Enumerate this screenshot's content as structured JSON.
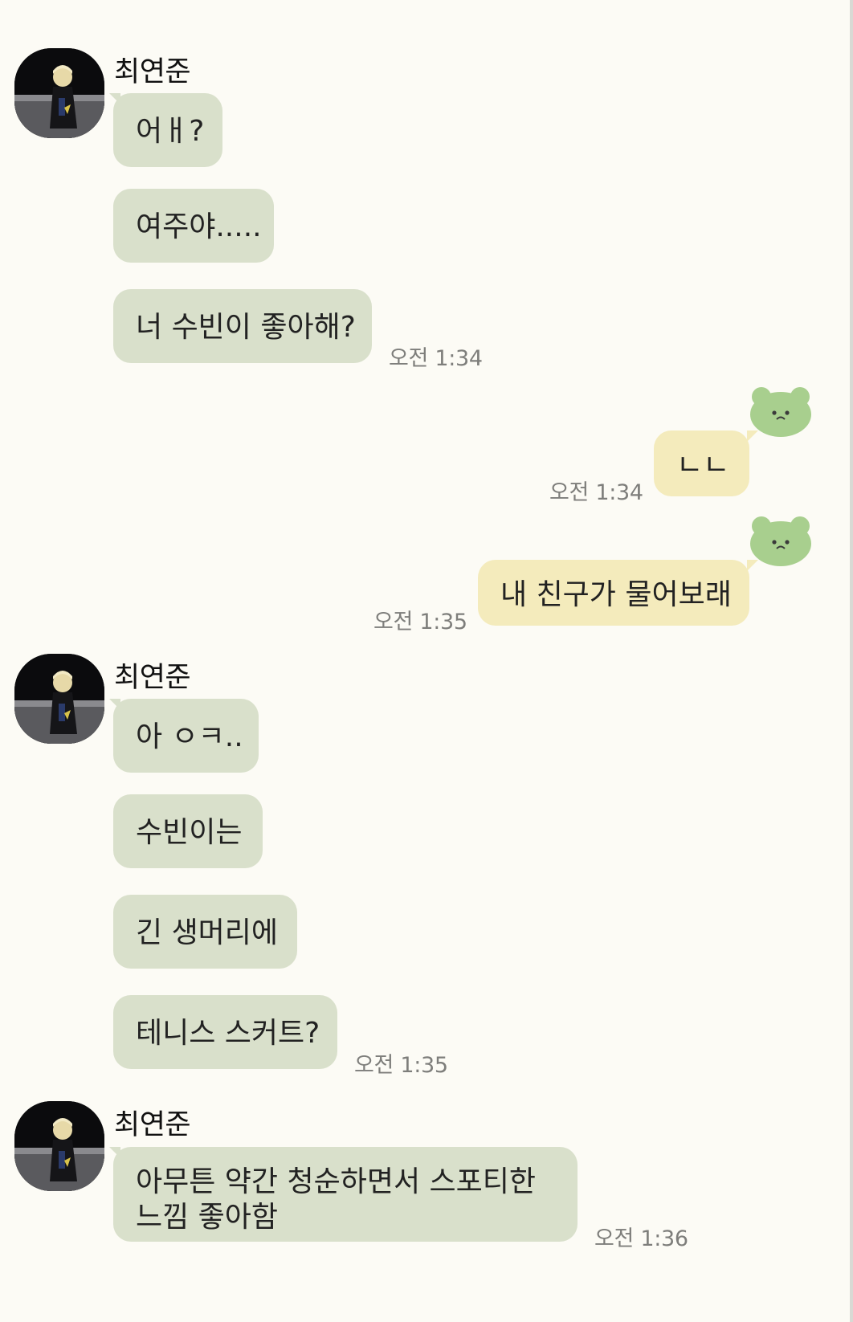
{
  "colors": {
    "background": "#fcfbf5",
    "incoming_bubble": "#d9e0cb",
    "outgoing_bubble": "#f4ebbc",
    "timestamp": "#7e7e7b",
    "bear_icon": "#a8cf8e"
  },
  "groups": [
    {
      "sender": "최연준",
      "avatar_icon": "profile-photo",
      "messages": [
        "어ㅐ?",
        "여주야.....",
        "너 수빈이 좋아해?"
      ],
      "time": "오전 1:34"
    },
    {
      "sender": "최연준",
      "avatar_icon": "profile-photo",
      "messages": [
        "아 ㅇㅋ..",
        "수빈이는",
        "긴 생머리에",
        "테니스 스커트?"
      ],
      "time": "오전 1:35"
    },
    {
      "sender": "최연준",
      "avatar_icon": "profile-photo",
      "messages": [
        "아무튼 약간 청순하면서 스포티한 느낌 좋아함"
      ],
      "time": "오전 1:36"
    }
  ],
  "outgoing": [
    {
      "avatar_icon": "green-bear-icon",
      "message": "ㄴㄴ",
      "time": "오전 1:34"
    },
    {
      "avatar_icon": "green-bear-icon",
      "message": "내 친구가 물어보래",
      "time": "오전 1:35"
    }
  ]
}
